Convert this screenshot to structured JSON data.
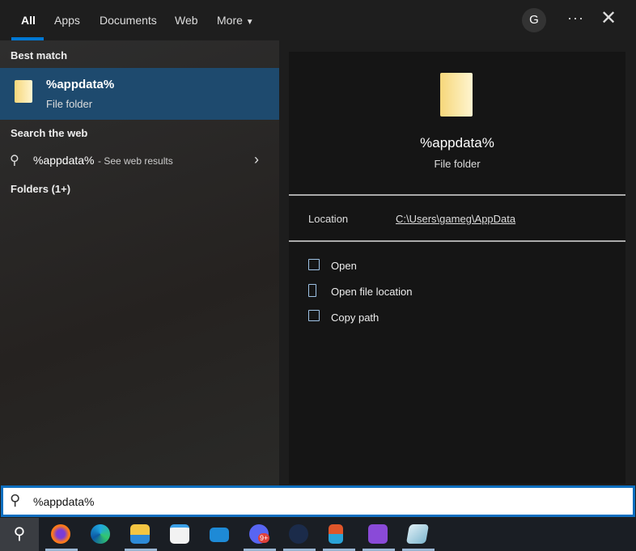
{
  "tabs": [
    "All",
    "Apps",
    "Documents",
    "Web",
    "More"
  ],
  "avatar_initial": "G",
  "left": {
    "best_match_label": "Best match",
    "best_match": {
      "title": "%appdata%",
      "subtitle": "File folder"
    },
    "search_web_label": "Search the web",
    "web_result": {
      "query": "%appdata%",
      "suffix": " - See web results"
    },
    "folders_label": "Folders (1+)"
  },
  "preview": {
    "title": "%appdata%",
    "subtitle": "File folder",
    "location_label": "Location",
    "location_value": "C:\\Users\\gameg\\AppData",
    "actions": [
      "Open",
      "Open file location",
      "Copy path"
    ]
  },
  "search": {
    "value": "%appdata%"
  },
  "taskbar": [
    "search-icon",
    "firefox-icon",
    "edge-icon",
    "file-explorer-icon",
    "store-icon",
    "mail-icon",
    "discord-icon",
    "steam-icon",
    "snipping-tool-icon",
    "visual-studio-icon",
    "notepad-icon"
  ],
  "discord_badge": "9+"
}
